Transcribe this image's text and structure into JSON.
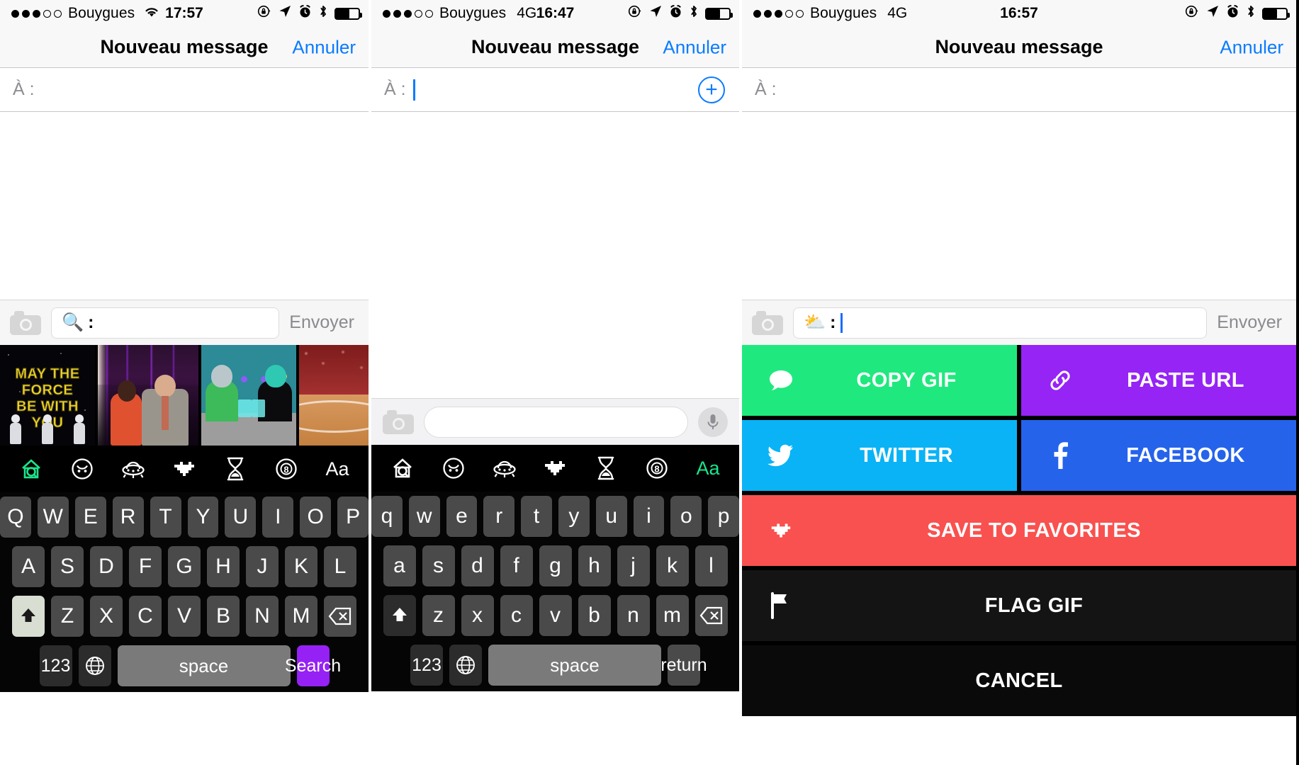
{
  "panels": [
    {
      "id": "panel-1",
      "status": {
        "carrier": "Bouygues",
        "network": "",
        "time": "17:57",
        "signal_filled": 3,
        "signal_total": 5,
        "wifi": true
      },
      "nav": {
        "title": "Nouveau message",
        "cancel": "Annuler"
      },
      "to_field": {
        "label": "À :",
        "value": "",
        "caret": false,
        "plus_button": false
      },
      "keyboard_search": {
        "camera_icon": "camera-icon",
        "emoji": "🔍",
        "colon": ":",
        "caret": false,
        "send_label": "Envoyer"
      },
      "gifs": [
        {
          "name": "star-wars-may-the-force",
          "caption_lines": [
            "MAY THE",
            "FORCE",
            "BE WITH",
            "YOU"
          ]
        },
        {
          "name": "red-carpet-couple",
          "caption_lines": []
        },
        {
          "name": "alien-bar-cartoon",
          "caption_lines": []
        },
        {
          "name": "basketball-court-crowd",
          "caption_lines": []
        }
      ],
      "emoji_tabs": [
        {
          "icon": "riffsy-home-icon",
          "label": "",
          "active": true
        },
        {
          "icon": "smiley-icon",
          "label": "",
          "active": false
        },
        {
          "icon": "ufo-icon",
          "label": "",
          "active": false
        },
        {
          "icon": "pixel-heart-icon",
          "label": "",
          "active": false
        },
        {
          "icon": "hourglass-icon",
          "label": "",
          "active": false
        },
        {
          "icon": "eight-ball-icon",
          "label": "",
          "active": false
        },
        {
          "icon": "text-mode-icon",
          "label": "Aa",
          "active": false
        }
      ],
      "keyboard": {
        "shift_state": "uppercase",
        "rows": [
          [
            "Q",
            "W",
            "E",
            "R",
            "T",
            "Y",
            "U",
            "I",
            "O",
            "P"
          ],
          [
            "A",
            "S",
            "D",
            "F",
            "G",
            "H",
            "J",
            "K",
            "L"
          ],
          [
            "Z",
            "X",
            "C",
            "V",
            "B",
            "N",
            "M"
          ]
        ],
        "shift_label": "shift-icon",
        "backspace_label": "backspace-icon",
        "num_label": "123",
        "globe_label": "globe-icon",
        "space_label": "space",
        "action_label": "Search",
        "action_color": "#9621f5"
      }
    },
    {
      "id": "panel-2",
      "status": {
        "carrier": "Bouygues",
        "network": "4G",
        "time": "16:47",
        "signal_filled": 3,
        "signal_total": 5,
        "wifi": false
      },
      "nav": {
        "title": "Nouveau message",
        "cancel": "Annuler"
      },
      "to_field": {
        "label": "À :",
        "value": "",
        "caret": true,
        "plus_button": true
      },
      "compose": {
        "camera_icon": "camera-icon",
        "value": "",
        "mic_icon": "microphone-icon"
      },
      "emoji_tabs": [
        {
          "icon": "riffsy-home-icon",
          "label": "",
          "active": false
        },
        {
          "icon": "smiley-icon",
          "label": "",
          "active": false
        },
        {
          "icon": "ufo-icon",
          "label": "",
          "active": false
        },
        {
          "icon": "pixel-heart-icon",
          "label": "",
          "active": false
        },
        {
          "icon": "hourglass-icon",
          "label": "",
          "active": false
        },
        {
          "icon": "eight-ball-icon",
          "label": "",
          "active": false
        },
        {
          "icon": "text-mode-icon",
          "label": "Aa",
          "active": true
        }
      ],
      "keyboard": {
        "shift_state": "lowercase",
        "rows": [
          [
            "q",
            "w",
            "e",
            "r",
            "t",
            "y",
            "u",
            "i",
            "o",
            "p"
          ],
          [
            "a",
            "s",
            "d",
            "f",
            "g",
            "h",
            "j",
            "k",
            "l"
          ],
          [
            "z",
            "x",
            "c",
            "v",
            "b",
            "n",
            "m"
          ]
        ],
        "shift_label": "shift-icon",
        "backspace_label": "backspace-icon",
        "num_label": "123",
        "globe_label": "globe-icon",
        "space_label": "space",
        "action_label": "return",
        "action_color": "#4a4a4a"
      }
    },
    {
      "id": "panel-3",
      "status": {
        "carrier": "Bouygues",
        "network": "4G",
        "time": "16:57",
        "signal_filled": 3,
        "signal_total": 5,
        "wifi": false
      },
      "nav": {
        "title": "Nouveau message",
        "cancel": "Annuler"
      },
      "to_field": {
        "label": "À :",
        "value": "",
        "caret": false,
        "plus_button": false
      },
      "keyboard_search": {
        "camera_icon": "camera-icon",
        "emoji": "⛅",
        "colon": ":",
        "caret": true,
        "send_label": "Envoyer"
      },
      "action_sheet": [
        {
          "label": "COPY GIF",
          "icon": "speech-bubble-icon",
          "color": "#1fe97e",
          "span": "half"
        },
        {
          "label": "PASTE URL",
          "icon": "link-icon",
          "color": "#9624f5",
          "span": "half"
        },
        {
          "label": "TWITTER",
          "icon": "twitter-bird-icon",
          "color": "#0ab3f5",
          "span": "half"
        },
        {
          "label": "FACEBOOK",
          "icon": "facebook-f-icon",
          "color": "#2563eb",
          "span": "half"
        },
        {
          "label": "SAVE TO FAVORITES",
          "icon": "pixel-heart-icon",
          "color": "#f9514f",
          "span": "full"
        },
        {
          "label": "FLAG GIF",
          "icon": "flag-icon",
          "color": "#141414",
          "span": "full"
        },
        {
          "label": "CANCEL",
          "icon": "",
          "color": "#0a0a0a",
          "span": "full"
        }
      ]
    }
  ]
}
